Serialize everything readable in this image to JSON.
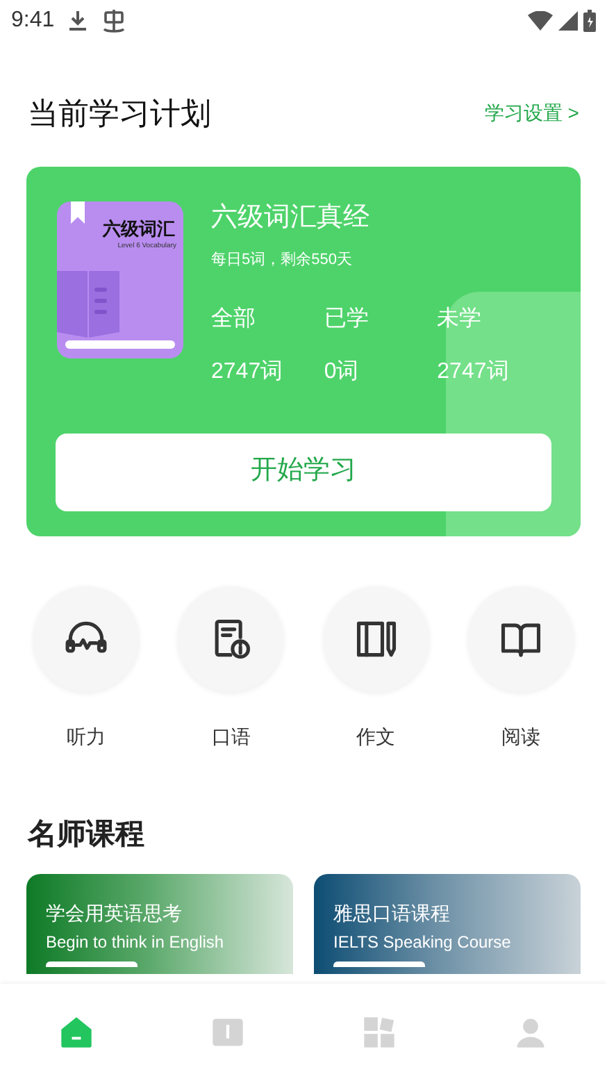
{
  "status_bar": {
    "time": "9:41"
  },
  "plan": {
    "title": "当前学习计划",
    "settings_link": "学习设置 >",
    "book_cover": {
      "title": "六级词汇",
      "subtitle": "Level 6 Vocabulary"
    },
    "book_title": "六级词汇真经",
    "schedule": "每日5词，剩余550天",
    "stats": [
      {
        "label": "全部",
        "value": "2747词"
      },
      {
        "label": "已学",
        "value": "0词"
      },
      {
        "label": "未学",
        "value": "2747词"
      }
    ],
    "start_button": "开始学习"
  },
  "skills": [
    {
      "kind": "headphones",
      "label": "听力"
    },
    {
      "kind": "speech",
      "label": "口语"
    },
    {
      "kind": "writing",
      "label": "作文"
    },
    {
      "kind": "reading",
      "label": "阅读"
    }
  ],
  "courses": {
    "title": "名师课程",
    "items": [
      {
        "kind": "green",
        "title": "学会用英语思考",
        "subtitle": "Begin to think in English"
      },
      {
        "kind": "blue",
        "title": "雅思口语课程",
        "subtitle": "IELTS Speaking Course"
      }
    ]
  },
  "bottom_nav": [
    {
      "kind": "home",
      "selected": true
    },
    {
      "kind": "book",
      "selected": false
    },
    {
      "kind": "grid",
      "selected": false
    },
    {
      "kind": "profile",
      "selected": false
    }
  ]
}
